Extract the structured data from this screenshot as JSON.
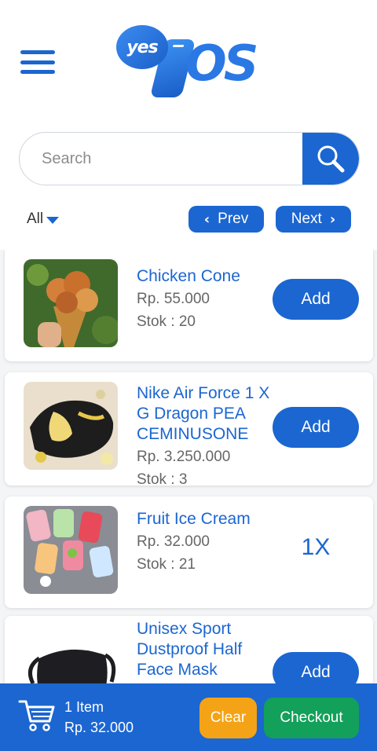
{
  "header": {
    "logo_yes": "yes",
    "logo_os": "OS"
  },
  "search": {
    "placeholder": "Search",
    "value": ""
  },
  "filter": {
    "selected": "All"
  },
  "pager": {
    "prev_label": "Prev",
    "next_label": "Next"
  },
  "products": [
    {
      "name": "Chicken Cone",
      "price": "Rp. 55.000",
      "stock": "Stok : 20",
      "action": "Add"
    },
    {
      "name": "Nike Air Force 1 X G Dragon PEA CEMINUSONE",
      "price": "Rp. 3.250.000",
      "stock": "Stok : 3",
      "action": "Add"
    },
    {
      "name": "Fruit Ice Cream",
      "price": "Rp. 32.000",
      "stock": "Stok : 21",
      "qty": "1X"
    },
    {
      "name": "Unisex Sport Dustproof Half Face Mask",
      "action": "Add"
    }
  ],
  "cart": {
    "count_label": "1 Item",
    "total": "Rp. 32.000",
    "clear_label": "Clear",
    "checkout_label": "Checkout"
  },
  "colors": {
    "primary": "#1b66d1",
    "clear": "#f5a316",
    "checkout": "#13a05a"
  }
}
